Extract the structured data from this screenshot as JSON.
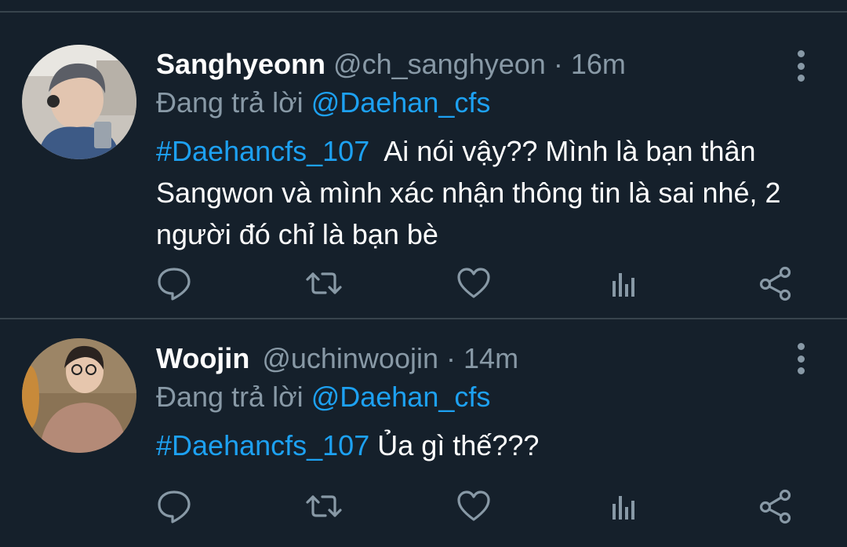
{
  "tweets": [
    {
      "name": "Sanghyeonn",
      "handle": "@ch_sanghyeon",
      "separator": "·",
      "time": "16m",
      "reply_prefix": "Đang trả lời",
      "reply_to": "@Daehan_cfs",
      "hashtag": "#Daehancfs_107",
      "text": "  Ai nói vậy?? Mình là bạn thân Sangwon và mình xác nhận thông tin là sai nhé, 2 người đó chỉ là bạn bè"
    },
    {
      "name": "Woojin",
      "handle": "@uchinwoojin",
      "separator": "·",
      "time": "14m",
      "reply_prefix": "Đang trả lời",
      "reply_to": "@Daehan_cfs",
      "hashtag": "#Daehancfs_107",
      "text": " Ủa gì thế???"
    }
  ],
  "actions": [
    "reply-icon",
    "retweet-icon",
    "like-icon",
    "analytics-icon",
    "share-icon"
  ],
  "colors": {
    "background": "#15202b",
    "divider": "#38444d",
    "secondary_text": "#8899a6",
    "accent": "#1da1f2",
    "primary_text": "#ffffff"
  }
}
